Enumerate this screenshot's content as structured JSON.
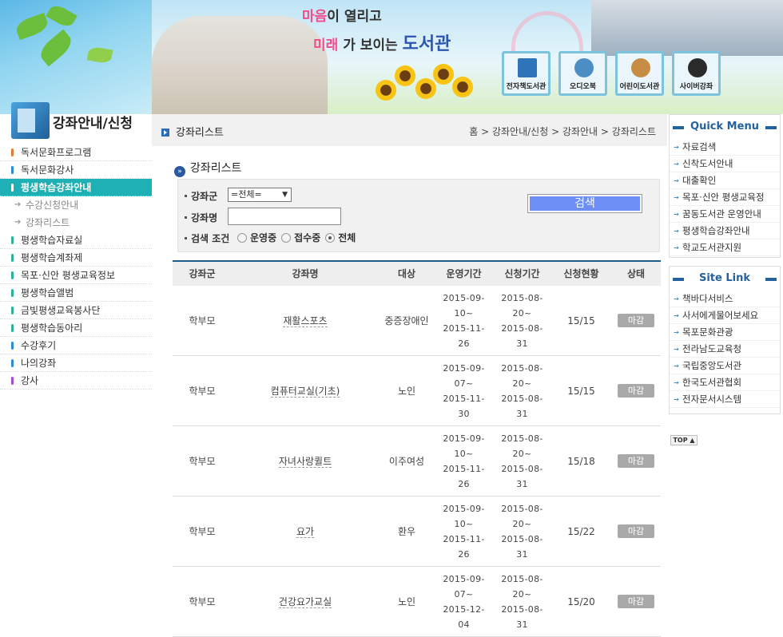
{
  "header": {
    "slogan_line1_hl": "마음",
    "slogan_line1_rest": "이 열리고",
    "slogan_line2_hl": "미래",
    "slogan_line2_rest": "가 보이는",
    "slogan_lib": "도서관",
    "quick_icons": [
      {
        "label": "전자책도서관",
        "icon": "monitor-icon"
      },
      {
        "label": "오디오북",
        "icon": "audio-cd-icon"
      },
      {
        "label": "어린이도서관",
        "icon": "egg-icon"
      },
      {
        "label": "사이버강좌",
        "icon": "headset-icon"
      }
    ]
  },
  "sidebar": {
    "title": "강좌안내/신청",
    "items": [
      {
        "label": "독서문화프로그램",
        "color": "#e07b39"
      },
      {
        "label": "독서문화강사",
        "color": "#2b8cd6"
      },
      {
        "label": "평생학습강좌안내",
        "color": "#ffffff",
        "active": true
      },
      {
        "label": "평생학습자료실",
        "color": "#2ab39b"
      },
      {
        "label": "평생학습계좌제",
        "color": "#2ab39b"
      },
      {
        "label": "목포·신안 평생교육정보",
        "color": "#2ab39b"
      },
      {
        "label": "평생학습앨범",
        "color": "#2ab39b"
      },
      {
        "label": "금빛평생교육봉사단",
        "color": "#2ab39b"
      },
      {
        "label": "평생학습동아리",
        "color": "#2ab39b"
      },
      {
        "label": "수강후기",
        "color": "#2b8cd6"
      },
      {
        "label": "나의강좌",
        "color": "#2b8cd6"
      },
      {
        "label": "강사",
        "color": "#a44fc7"
      }
    ],
    "sub_items": [
      "수강신청안내",
      "강좌리스트"
    ]
  },
  "crumb": {
    "title": "강좌리스트",
    "path": "홈 > 강좌안내/신청 > 강좌안내 > 강좌리스트"
  },
  "section_title": "강좌리스트",
  "search": {
    "group_label": "강좌군",
    "group_value": "=전체=",
    "name_label": "강좌명",
    "name_value": "",
    "cond_label": "검색 조건",
    "options": [
      "운영중",
      "접수중",
      "전체"
    ],
    "selected_option": "전체",
    "button_label": "검색"
  },
  "table": {
    "headers": [
      "강좌군",
      "강좌명",
      "대상",
      "운영기간",
      "신청기간",
      "신청현황",
      "상태"
    ],
    "rows": [
      {
        "group": "학부모",
        "name": "재활스포츠",
        "target": "중증장애인",
        "op": "2015-09-\n10~\n2015-11-\n26",
        "apply": "2015-08-\n20~\n2015-08-\n31",
        "count": "15/15",
        "status": "마감"
      },
      {
        "group": "학부모",
        "name": "컴퓨터교실(기초)",
        "target": "노인",
        "op": "2015-09-\n07~\n2015-11-\n30",
        "apply": "2015-08-\n20~\n2015-08-\n31",
        "count": "15/15",
        "status": "마감"
      },
      {
        "group": "학부모",
        "name": "자녀사랑퀼트",
        "target": "이주여성",
        "op": "2015-09-\n10~\n2015-11-\n26",
        "apply": "2015-08-\n20~\n2015-08-\n31",
        "count": "15/18",
        "status": "마감"
      },
      {
        "group": "학부모",
        "name": "요가",
        "target": "환우",
        "op": "2015-09-\n10~\n2015-11-\n26",
        "apply": "2015-08-\n20~\n2015-08-\n31",
        "count": "15/22",
        "status": "마감"
      },
      {
        "group": "학부모",
        "name": "건강요가교실",
        "target": "노인",
        "op": "2015-09-\n07~\n2015-12-\n04",
        "apply": "2015-08-\n20~\n2015-08-\n31",
        "count": "15/20",
        "status": "마감"
      }
    ]
  },
  "quick_menu": {
    "title": "Quick Menu",
    "items": [
      "자료검색",
      "신착도서안내",
      "대출확인",
      "목포·신안 평생교육정",
      "꿈동도서관 운영안내",
      "평생학습강좌안내",
      "학교도서관지원"
    ]
  },
  "site_link": {
    "title": "Site Link",
    "items": [
      "책바다서비스",
      "사서에게물어보세요",
      "목포문화관광",
      "전라남도교육청",
      "국립중앙도서관",
      "한국도서관협회",
      "전자문서시스템"
    ]
  },
  "top_button": "TOP ▲"
}
